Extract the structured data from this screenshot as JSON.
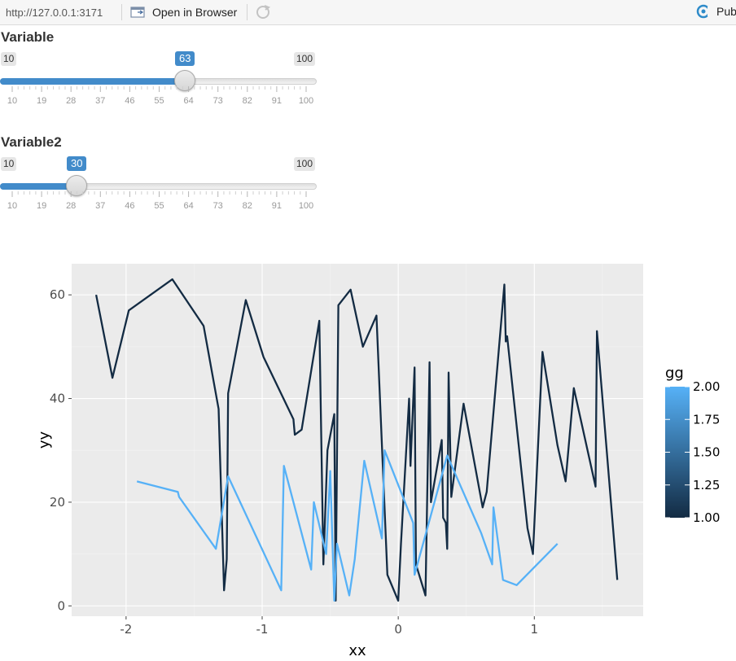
{
  "toolbar": {
    "url": "http://127.0.0.1:3171",
    "open_in_browser_label": "Open in Browser",
    "publish_label": "Pub"
  },
  "sliders": [
    {
      "label": "Variable",
      "min": "10",
      "max": "100",
      "value": "63",
      "ticks": [
        "10",
        "19",
        "28",
        "37",
        "46",
        "55",
        "64",
        "73",
        "82",
        "91",
        "100"
      ]
    },
    {
      "label": "Variable2",
      "min": "10",
      "max": "100",
      "value": "30",
      "ticks": [
        "10",
        "19",
        "28",
        "37",
        "46",
        "55",
        "64",
        "73",
        "82",
        "91",
        "100"
      ]
    }
  ],
  "colors": {
    "accent": "#428bca",
    "plot_bg": "#ebebeb",
    "series_dark": "#132b43",
    "series_light": "#56b1f7"
  },
  "chart_data": {
    "type": "line",
    "xlabel": "xx",
    "ylabel": "yy",
    "xlim": [
      -2.4,
      1.8
    ],
    "ylim": [
      -2,
      66
    ],
    "x_ticks": [
      -2,
      -1,
      0,
      1
    ],
    "x_tick_labels": [
      "-2",
      "-1",
      "0",
      "1"
    ],
    "y_ticks": [
      0,
      20,
      40,
      60
    ],
    "y_tick_labels": [
      "0",
      "20",
      "40",
      "60"
    ],
    "grid": true,
    "legend": {
      "title": "gg",
      "position": "right",
      "type": "colorbar",
      "range": [
        1.0,
        2.0
      ],
      "ticks": [
        "2.00",
        "1.75",
        "1.50",
        "1.25",
        "1.00"
      ]
    },
    "series": [
      {
        "gg": 1,
        "color": "#132b43",
        "points": [
          [
            -2.22,
            60
          ],
          [
            -2.1,
            44
          ],
          [
            -1.98,
            57
          ],
          [
            -1.66,
            63
          ],
          [
            -1.43,
            54
          ],
          [
            -1.32,
            38
          ],
          [
            -1.28,
            3
          ],
          [
            -1.26,
            9
          ],
          [
            -1.25,
            41
          ],
          [
            -1.12,
            59
          ],
          [
            -0.99,
            48
          ],
          [
            -0.77,
            36
          ],
          [
            -0.76,
            33
          ],
          [
            -0.71,
            34
          ],
          [
            -0.58,
            55
          ],
          [
            -0.55,
            8
          ],
          [
            -0.52,
            30
          ],
          [
            -0.47,
            37
          ],
          [
            -0.46,
            1
          ],
          [
            -0.44,
            58
          ],
          [
            -0.35,
            61
          ],
          [
            -0.26,
            50
          ],
          [
            -0.16,
            56
          ],
          [
            -0.08,
            6
          ],
          [
            0.0,
            1
          ],
          [
            0.02,
            12
          ],
          [
            0.08,
            40
          ],
          [
            0.09,
            27
          ],
          [
            0.12,
            46
          ],
          [
            0.13,
            8
          ],
          [
            0.2,
            2
          ],
          [
            0.23,
            47
          ],
          [
            0.24,
            20
          ],
          [
            0.32,
            32
          ],
          [
            0.33,
            17
          ],
          [
            0.35,
            16
          ],
          [
            0.36,
            11
          ],
          [
            0.37,
            45
          ],
          [
            0.39,
            21
          ],
          [
            0.48,
            39
          ],
          [
            0.62,
            19
          ],
          [
            0.65,
            22
          ],
          [
            0.78,
            62
          ],
          [
            0.79,
            51
          ],
          [
            0.8,
            52
          ],
          [
            0.95,
            15
          ],
          [
            0.99,
            10
          ],
          [
            1.06,
            49
          ],
          [
            1.17,
            31
          ],
          [
            1.23,
            24
          ],
          [
            1.29,
            42
          ],
          [
            1.45,
            23
          ],
          [
            1.46,
            53
          ],
          [
            1.61,
            5
          ]
        ]
      },
      {
        "gg": 2,
        "color": "#56b1f7",
        "points": [
          [
            -1.92,
            24
          ],
          [
            -1.62,
            22
          ],
          [
            -1.61,
            21
          ],
          [
            -1.34,
            11
          ],
          [
            -1.25,
            25
          ],
          [
            -0.86,
            3
          ],
          [
            -0.84,
            27
          ],
          [
            -0.64,
            7
          ],
          [
            -0.62,
            20
          ],
          [
            -0.53,
            10
          ],
          [
            -0.5,
            26
          ],
          [
            -0.47,
            1
          ],
          [
            -0.45,
            12
          ],
          [
            -0.36,
            2
          ],
          [
            -0.32,
            9
          ],
          [
            -0.25,
            28
          ],
          [
            -0.12,
            13
          ],
          [
            -0.1,
            30
          ],
          [
            0.11,
            16
          ],
          [
            0.12,
            6
          ],
          [
            0.36,
            29
          ],
          [
            0.61,
            14
          ],
          [
            0.69,
            8
          ],
          [
            0.7,
            19
          ],
          [
            0.77,
            5
          ],
          [
            0.87,
            4
          ],
          [
            1.17,
            12
          ]
        ]
      }
    ]
  }
}
